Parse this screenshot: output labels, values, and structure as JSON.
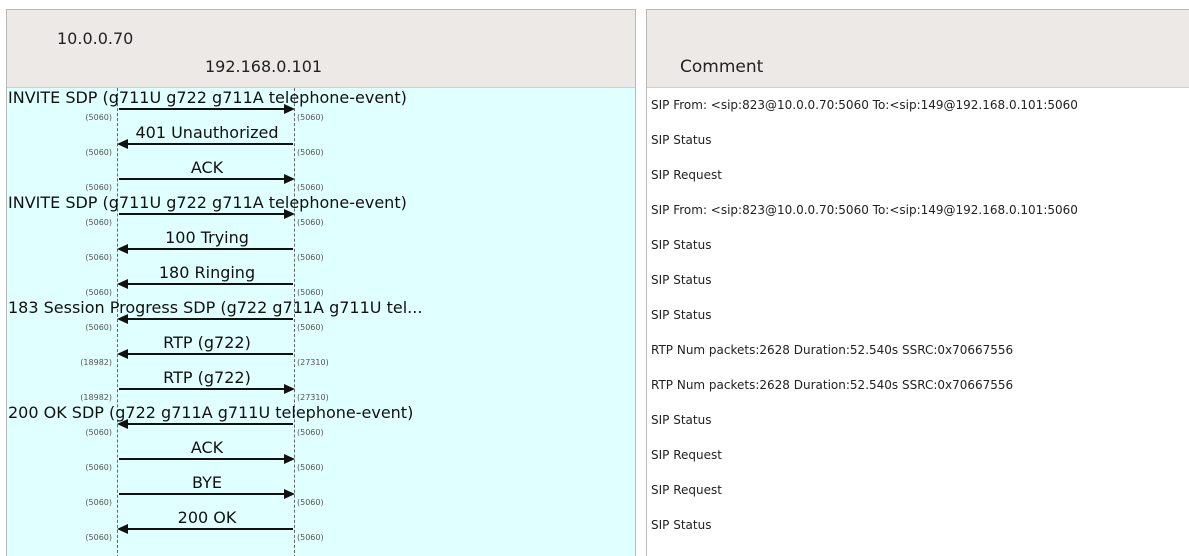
{
  "flow": {
    "host_a": "10.0.0.70",
    "host_b": "192.168.0.101",
    "rows": [
      {
        "label": "INVITE SDP (g711U g722 g711A telephone-event)",
        "dir": "right",
        "port_a": "(5060)",
        "port_b": "(5060)",
        "wide": true
      },
      {
        "label": "401 Unauthorized",
        "dir": "left",
        "port_a": "(5060)",
        "port_b": "(5060)",
        "wide": false
      },
      {
        "label": "ACK",
        "dir": "right",
        "port_a": "(5060)",
        "port_b": "(5060)",
        "wide": false
      },
      {
        "label": "INVITE SDP (g711U g722 g711A telephone-event)",
        "dir": "right",
        "port_a": "(5060)",
        "port_b": "(5060)",
        "wide": true
      },
      {
        "label": "100 Trying",
        "dir": "left",
        "port_a": "(5060)",
        "port_b": "(5060)",
        "wide": false
      },
      {
        "label": "180 Ringing",
        "dir": "left",
        "port_a": "(5060)",
        "port_b": "(5060)",
        "wide": false
      },
      {
        "label": "183 Session Progress SDP (g722 g711A g711U tel...",
        "dir": "left",
        "port_a": "(5060)",
        "port_b": "(5060)",
        "wide": true
      },
      {
        "label": "RTP (g722)",
        "dir": "left",
        "port_a": "(18982)",
        "port_b": "(27310)",
        "wide": false
      },
      {
        "label": "RTP (g722)",
        "dir": "right",
        "port_a": "(18982)",
        "port_b": "(27310)",
        "wide": false
      },
      {
        "label": "200 OK SDP (g722 g711A g711U telephone-event)",
        "dir": "left",
        "port_a": "(5060)",
        "port_b": "(5060)",
        "wide": true
      },
      {
        "label": "ACK",
        "dir": "right",
        "port_a": "(5060)",
        "port_b": "(5060)",
        "wide": false
      },
      {
        "label": "BYE",
        "dir": "right",
        "port_a": "(5060)",
        "port_b": "(5060)",
        "wide": false
      },
      {
        "label": "200 OK",
        "dir": "left",
        "port_a": "(5060)",
        "port_b": "(5060)",
        "wide": false
      }
    ]
  },
  "comments": {
    "header": "Comment",
    "rows": [
      "SIP From: <sip:823@10.0.0.70:5060 To:<sip:149@192.168.0.101:5060",
      "SIP Status",
      "SIP Request",
      "SIP From:  <sip:823@10.0.0.70:5060 To:<sip:149@192.168.0.101:5060",
      "SIP Status",
      "SIP Status",
      "SIP Status",
      "RTP Num packets:2628  Duration:52.540s SSRC:0x70667556",
      "RTP Num packets:2628  Duration:52.540s SSRC:0x70667556",
      "SIP Status",
      "SIP Request",
      "SIP Request",
      "SIP Status"
    ]
  }
}
